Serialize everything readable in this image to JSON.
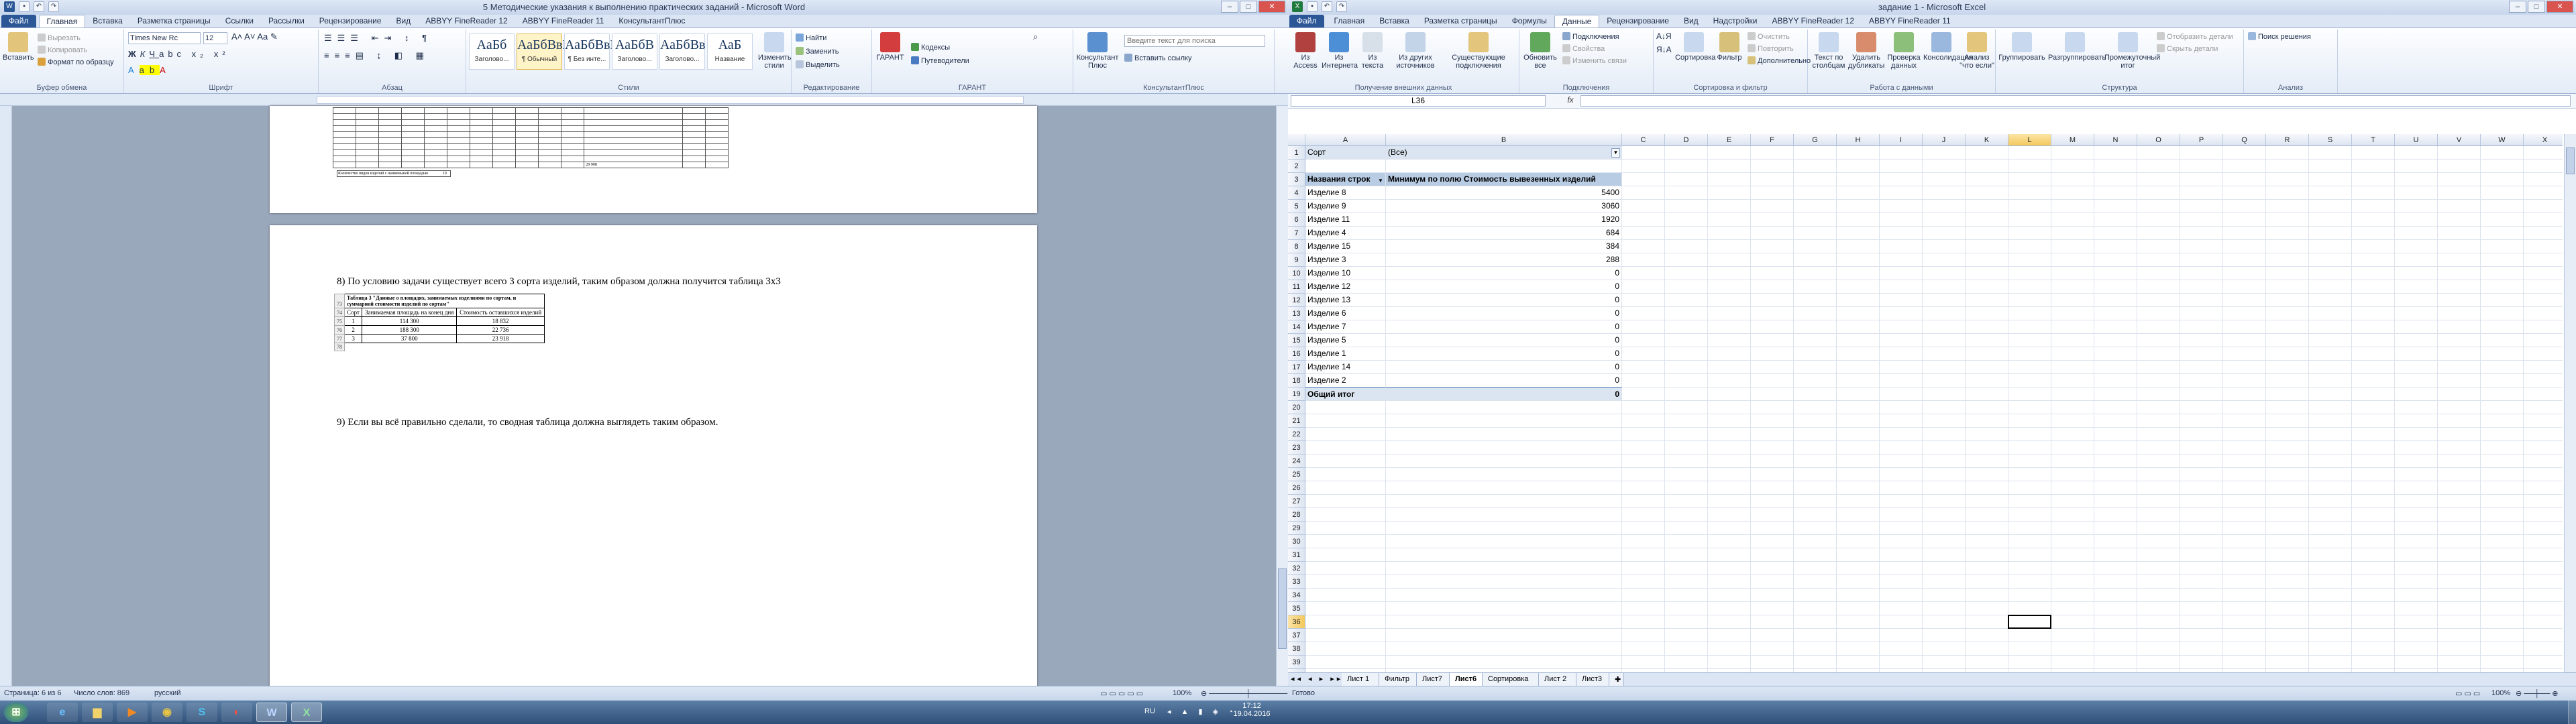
{
  "word": {
    "title": "5 Методические указания к выполнению практических заданий - Microsoft Word",
    "tabs": [
      "Файл",
      "Главная",
      "Вставка",
      "Разметка страницы",
      "Ссылки",
      "Рассылки",
      "Рецензирование",
      "Вид",
      "ABBYY FineReader 12",
      "ABBYY FineReader 11",
      "КонсультантПлюс"
    ],
    "ribbon": {
      "paste": "Вставить",
      "cut": "Вырезать",
      "copy": "Копировать",
      "format_painter": "Формат по образцу",
      "clipboard": "Буфер обмена",
      "font_name": "Times New Rc",
      "font_size": "12",
      "font_group": "Шрифт",
      "paragraph_group": "Абзац",
      "styles": [
        {
          "sample": "АаБб",
          "name": "Заголово..."
        },
        {
          "sample": "АаБбВвГ",
          "name": "¶ Обычный"
        },
        {
          "sample": "АаБбВвГ",
          "name": "¶ Без инте..."
        },
        {
          "sample": "АаБбВ",
          "name": "Заголово..."
        },
        {
          "sample": "АаБбВв",
          "name": "Заголово..."
        },
        {
          "sample": "АаБ",
          "name": "Название"
        }
      ],
      "change_styles": "Изменить стили",
      "styles_group": "Стили",
      "find": "Найти",
      "replace": "Заменить",
      "select": "Выделить",
      "editing_group": "Редактирование",
      "garant": "ГАРАНТ",
      "kodeksy": "Кодексы",
      "putevoditeli": "Путеводители",
      "garant_group": "ГАРАНТ",
      "konsultant": "Консультант Плюс",
      "search_placeholder": "Введите текст для поиска",
      "insert_link": "Вставить ссылку",
      "konsultant_group": "КонсультантПлюс"
    },
    "doc": {
      "step8": "8)   По условию задачи существует всего 3 сорта изделий, таким образом должна получится таблица 3х3",
      "table_caption": "Таблица 3 \"Данные о площадях, занимаемых изделиями по сортам, и суммарной стоимости изделий по сортам\"",
      "rownums": [
        "73",
        "74",
        "75",
        "76",
        "77",
        "78",
        "79"
      ],
      "headers": [
        "Сорт",
        "Занимаемая площадь на конец дня",
        "Стоимость оставшихся изделий"
      ],
      "rows": [
        [
          "1",
          "114 300",
          "18 832"
        ],
        [
          "2",
          "188 300",
          "22 736"
        ],
        [
          "3",
          "37 800",
          "23 918"
        ]
      ],
      "step9": "9)   Если вы всё правильно сделали, то сводная таблица должна выглядеть таким образом.",
      "mini_total_label": "Количество видов изделий с наименьшей площадью",
      "mini_total_value": "10",
      "mini_sum": "29 908"
    },
    "status": {
      "page": "Страница: 6 из 6",
      "words": "Число слов: 869",
      "lang": "русский",
      "zoom": "100%"
    }
  },
  "excel": {
    "title": "задание 1 - Microsoft Excel",
    "tabs": [
      "Файл",
      "Главная",
      "Вставка",
      "Разметка страницы",
      "Формулы",
      "Данные",
      "Рецензирование",
      "Вид",
      "Надстройки",
      "ABBYY FineReader 12",
      "ABBYY FineReader 11"
    ],
    "ribbon": {
      "from_access": "Из Access",
      "from_web": "Из Интернета",
      "from_text": "Из текста",
      "from_other": "Из других источников",
      "existing": "Существующие подключения",
      "ext_group": "Получение внешних данных",
      "refresh": "Обновить все",
      "connections": "Подключения",
      "properties": "Свойства",
      "edit_links": "Изменить связи",
      "conn_group": "Подключения",
      "sort": "Сортировка",
      "filter": "Фильтр",
      "clear": "Очистить",
      "reapply": "Повторить",
      "advanced": "Дополнительно",
      "sort_group": "Сортировка и фильтр",
      "text_to_cols": "Текст по столбцам",
      "remove_dup": "Удалить дубликаты",
      "validation": "Проверка данных",
      "consolidate": "Консолидация",
      "whatif": "Анализ \"что если\"",
      "data_group": "Работа с данными",
      "group": "Группировать",
      "ungroup": "Разгруппировать",
      "subtotal": "Промежуточный итог",
      "show_detail": "Отобразить детали",
      "hide_detail": "Скрыть детали",
      "outline_group": "Структура",
      "solver": "Поиск решения",
      "analysis_group": "Анализ"
    },
    "namebox": "L36",
    "fx": "fx",
    "columns": [
      "A",
      "B",
      "C",
      "D",
      "E",
      "F",
      "G",
      "H",
      "I",
      "J",
      "K",
      "L",
      "M",
      "N",
      "O",
      "P",
      "Q",
      "R",
      "S",
      "T",
      "U",
      "V",
      "W",
      "X"
    ],
    "rows_count": 41,
    "filter_label": "Сорт",
    "filter_value": "(Все)",
    "header_rows": "Названия строк",
    "header_value": "Минимум по полю Стоимость вывезенных изделий",
    "pivot": [
      [
        "Изделие 8",
        "5400"
      ],
      [
        "Изделие 9",
        "3060"
      ],
      [
        "Изделие 11",
        "1920"
      ],
      [
        "Изделие 4",
        "684"
      ],
      [
        "Изделие 15",
        "384"
      ],
      [
        "Изделие 3",
        "288"
      ],
      [
        "Изделие 10",
        "0"
      ],
      [
        "Изделие 12",
        "0"
      ],
      [
        "Изделие 13",
        "0"
      ],
      [
        "Изделие 6",
        "0"
      ],
      [
        "Изделие 7",
        "0"
      ],
      [
        "Изделие 5",
        "0"
      ],
      [
        "Изделие 1",
        "0"
      ],
      [
        "Изделие 14",
        "0"
      ],
      [
        "Изделие 2",
        "0"
      ]
    ],
    "total_label": "Общий итог",
    "total_value": "0",
    "sheets": [
      "Лист 1",
      "Фильтр",
      "Лист7",
      "Лист6",
      "Сортировка",
      "Лист 2",
      "Лист3"
    ],
    "active_sheet": "Лист6",
    "status": {
      "ready": "Готово",
      "zoom": "100%"
    }
  },
  "taskbar": {
    "lang": "RU",
    "time": "17:12",
    "date": "19.04.2016",
    "apps": [
      "start",
      "ie",
      "explorer",
      "media",
      "chrome",
      "skype",
      "word",
      "excel"
    ]
  }
}
